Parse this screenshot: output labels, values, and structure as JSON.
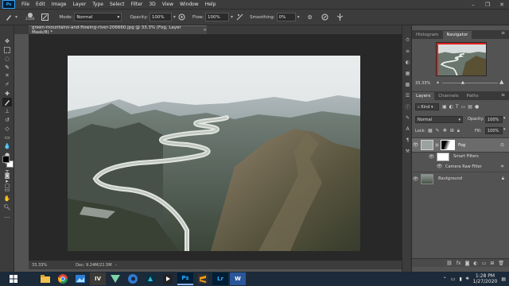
{
  "menu": {
    "app_icon": "Ps",
    "items": [
      "File",
      "Edit",
      "Image",
      "Layer",
      "Type",
      "Select",
      "Filter",
      "3D",
      "View",
      "Window",
      "Help"
    ],
    "window_controls": [
      "minimize-icon",
      "restore-icon",
      "close-icon"
    ]
  },
  "options": {
    "brush_size": "2100",
    "mode_label": "Mode:",
    "mode_value": "Normal",
    "opacity_label": "Opacity:",
    "opacity_value": "100%",
    "flow_label": "Flow:",
    "flow_value": "100%",
    "smoothing_label": "Smoothing:",
    "smoothing_value": "0%"
  },
  "document": {
    "tab_title": "green-mountains-and-flowing-river-206660.jpg @ 33.3% (Fog, Layer Mask/8) *",
    "close": "×",
    "zoom": "33.33%",
    "doc_size": "Doc: 9.24M/21.5M"
  },
  "navigator": {
    "tabs": [
      "Histogram",
      "Navigator"
    ],
    "active_tab": "Navigator",
    "zoom": "33.33%"
  },
  "layers": {
    "tabs": [
      "Layers",
      "Channels",
      "Paths"
    ],
    "active_tab": "Layers",
    "kind_label": "Kind",
    "blend_mode": "Normal",
    "opacity_label": "Opacity:",
    "opacity_value": "100%",
    "lock_label": "Lock:",
    "fill_label": "Fill:",
    "fill_value": "100%",
    "rows": [
      {
        "name": "Fog",
        "type": "smart-object"
      },
      {
        "name": "Smart Filters",
        "type": "filter-group"
      },
      {
        "name": "Camera Raw Filter",
        "type": "filter"
      },
      {
        "name": "Background",
        "type": "background"
      }
    ]
  },
  "taskbar": {
    "apps": [
      "file-explorer",
      "chrome",
      "photos",
      "illustrator-like",
      "vectornator",
      "edge",
      "premiere",
      "photoshop",
      "sublime",
      "lightroom",
      "word"
    ],
    "labels": {
      "ps": "Ps",
      "lr": "Lr",
      "w": "W",
      "iv": "IV"
    },
    "time": "1:28 PM",
    "date": "1/27/2020"
  },
  "colors": {
    "foreground": "#000000",
    "background": "#ffffff",
    "accent": "#31a8ff"
  }
}
